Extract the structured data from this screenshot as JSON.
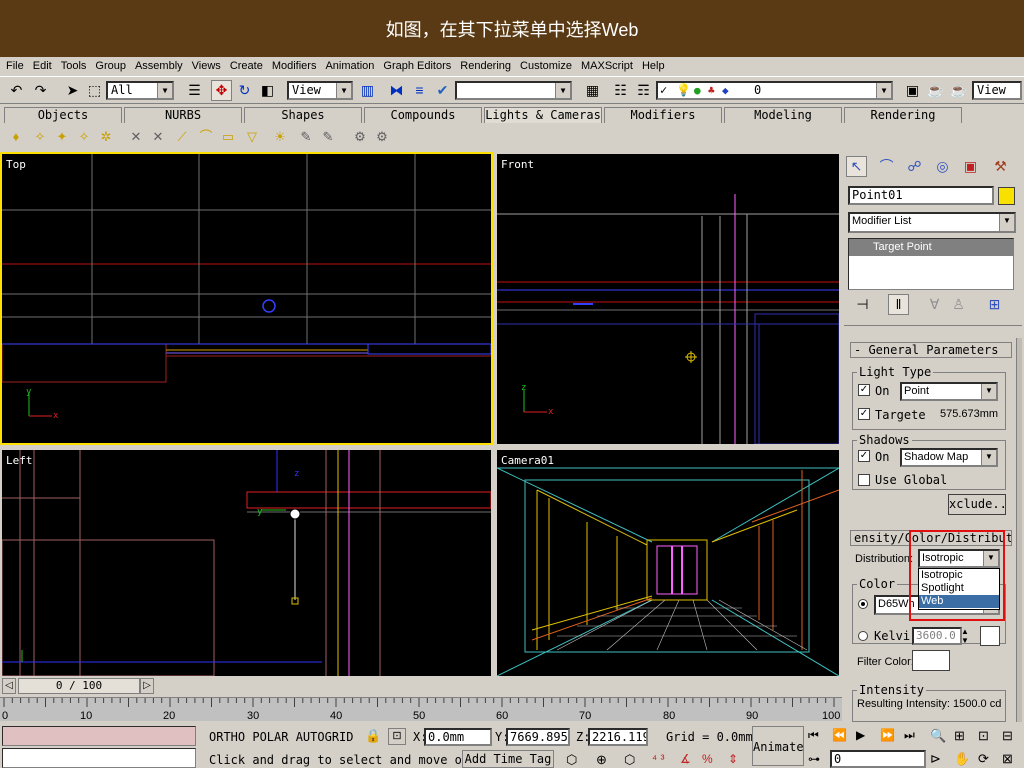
{
  "banner": {
    "caption": "如图，在其下拉菜单中选择Web"
  },
  "menu": [
    "File",
    "Edit",
    "Tools",
    "Group",
    "Assembly",
    "Views",
    "Create",
    "Modifiers",
    "Animation",
    "Graph Editors",
    "Rendering",
    "Customize",
    "MAXScript",
    "Help"
  ],
  "toolbar": {
    "selection_filter": "All",
    "ref_coord": "View",
    "layer_value": "0",
    "right_view": "View"
  },
  "tabs": [
    "Objects",
    "NURBS",
    "Shapes",
    "Compounds",
    "Lights & Cameras",
    "Modifiers",
    "Modeling",
    "Rendering"
  ],
  "viewports": {
    "top": "Top",
    "front": "Front",
    "left": "Left",
    "camera": "Camera01"
  },
  "time_slider": {
    "position": "0 / 100"
  },
  "trackbar": {
    "ticks": [
      "0",
      "10",
      "20",
      "30",
      "40",
      "50",
      "60",
      "70",
      "80",
      "90",
      "100"
    ]
  },
  "status": {
    "modes": "ORTHO  POLAR  AUTOGRID",
    "x_label": "X:",
    "x_value": "0.0mm",
    "y_label": "Y:",
    "y_value": "7669.895",
    "z_label": "Z:",
    "z_value": "2216.119",
    "grid": "Grid = 0.0mm",
    "animate": "Animate",
    "prompt": "Click and drag to select and move o",
    "add_time_tag": "Add Time Tag",
    "frame": "0"
  },
  "command_panel": {
    "object_name": "Point01",
    "object_color": "#f8e000",
    "modifier_list": "Modifier List",
    "stack_item": "Target Point",
    "general_parameters": "- General Parameters",
    "light_type_title": "Light Type",
    "on_label": "On",
    "light_type_value": "Point",
    "targeted_label": "Targete",
    "target_distance": "575.673mm",
    "shadows_title": "Shadows",
    "shadows_on_label": "On",
    "shadow_type": "Shadow Map",
    "use_global": "Use Global",
    "exclude_button": "xclude..",
    "intensity_rollout": "ensity/Color/Distribut",
    "distribution_label": "Distribution:",
    "distribution_value": "Isotropic",
    "distribution_options": [
      "Isotropic",
      "Spotlight",
      "Web"
    ],
    "color_title": "Color",
    "color_preset": "D65Wh",
    "kelvin_label": "Kelvi",
    "kelvin_value": "3600.0",
    "filter_color_label": "Filter Color:",
    "intensity_title": "Intensity",
    "resulting_intensity": "Resulting Intensity: 1500.0 cd"
  },
  "colors": {
    "highlight": "#e01010",
    "active_viewport": "#ffe000",
    "selection": "#3a6ea5"
  }
}
